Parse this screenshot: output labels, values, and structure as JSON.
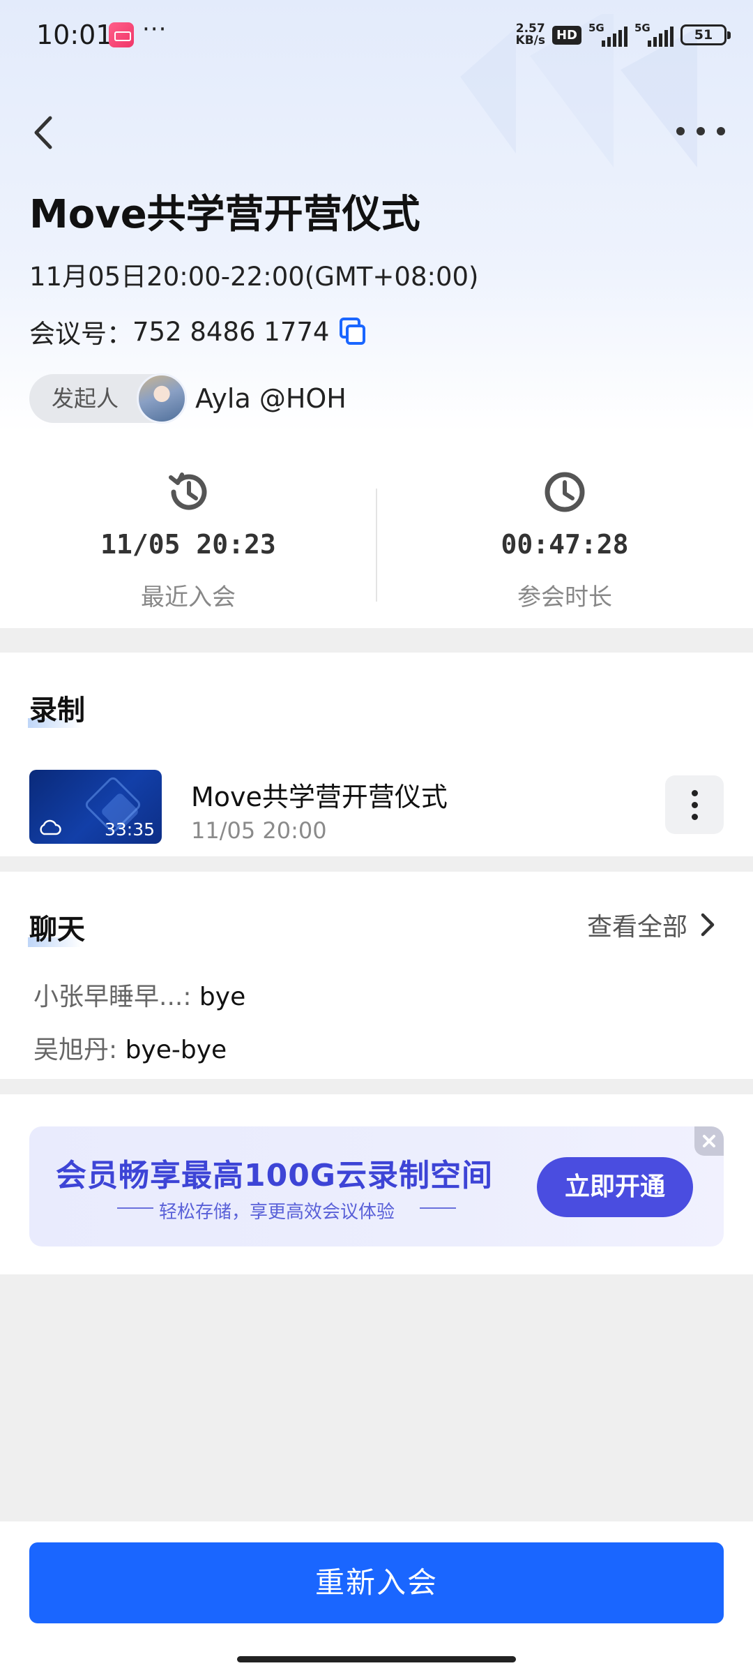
{
  "status_bar": {
    "time": "10:01",
    "dots": "···",
    "net_speed_value": "2.57",
    "net_speed_unit": "KB/s",
    "hd_label": "HD",
    "signal_1": "5G",
    "signal_2": "5G",
    "battery": "51"
  },
  "nav": {
    "back_icon": "chevron-left-icon",
    "more_icon": "more-horizontal-icon"
  },
  "meeting": {
    "title": "Move共学营开营仪式",
    "datetime": "11月05日20:00-22:00(GMT+08:00)",
    "id_label": "会议号：",
    "id_value": "752 8486 1774",
    "host_label": "发起人",
    "host_name": "Ayla @HOH"
  },
  "stats": {
    "recent_join_value": "11/05 20:23",
    "recent_join_label": "最近入会",
    "duration_value": "00:47:28",
    "duration_label": "参会时长"
  },
  "recording": {
    "section_title": "录制",
    "item_title": "Move共学营开营仪式",
    "item_date": "11/05 20:00",
    "duration": "33:35"
  },
  "chat": {
    "section_title": "聊天",
    "view_all": "查看全部",
    "messages": [
      {
        "who": "小张早睡早...: ",
        "msg": "bye"
      },
      {
        "who": "吴旭丹: ",
        "msg": "bye-bye"
      }
    ]
  },
  "promo": {
    "title": "会员畅享最高100G云录制空间",
    "subtitle": "轻松存储，享更高效会议体验",
    "button": "立即开通"
  },
  "footer": {
    "rejoin": "重新入会"
  },
  "colors": {
    "primary": "#1a66ff",
    "promo_accent": "#4a4de0",
    "muted": "#888888"
  }
}
